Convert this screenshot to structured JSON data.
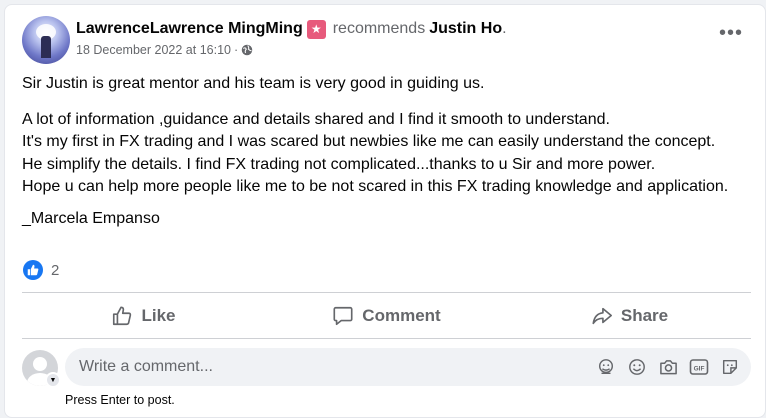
{
  "post": {
    "author": "LawrenceLawrence MingMing",
    "verb": "recommends",
    "target": "Justin Ho",
    "period": ".",
    "timestamp": "18 December 2022 at 16:10",
    "dot": "·",
    "more": "•••",
    "paragraphs": [
      "Sir Justin is great mentor and his team is very good in guiding us.",
      "A lot of information ,guidance and details shared  and I find it smooth to understand.",
      "It's my first in FX trading  and I was scared but newbies like me can easily understand the concept.",
      "He simplify the details. I find FX trading not complicated...thanks to u Sir and more power.",
      "Hope u can help more people  like me to be not scared in this FX trading knowledge and application.",
      "_Marcela Empanso"
    ],
    "reactions_count": "2"
  },
  "actions": {
    "like": "Like",
    "comment": "Comment",
    "share": "Share"
  },
  "composer": {
    "placeholder": "Write a comment...",
    "hint": "Press Enter to post."
  },
  "colors": {
    "accent": "#1877f2",
    "secondary_text": "#65676b",
    "badge": "#e75a7c"
  }
}
